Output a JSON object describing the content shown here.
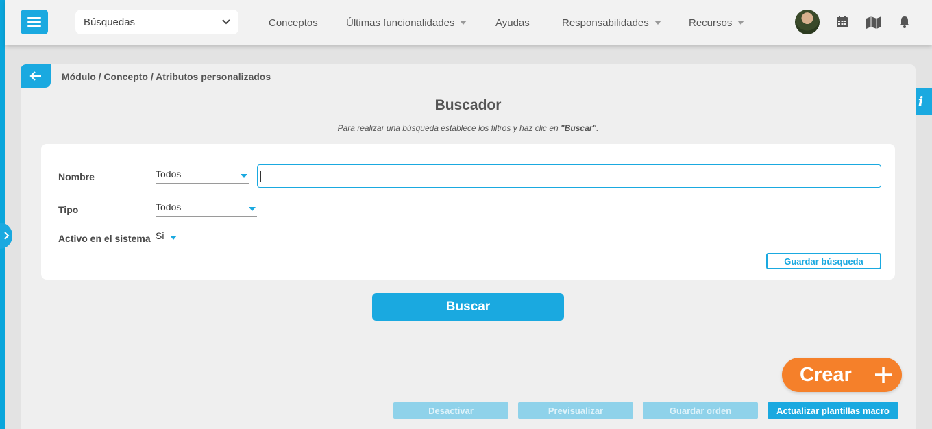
{
  "header": {
    "search_select": "Búsquedas",
    "nav": [
      {
        "label": "Conceptos",
        "has_caret": false
      },
      {
        "label": "Últimas funcionalidades",
        "has_caret": true
      },
      {
        "label": "Ayudas",
        "has_caret": false
      },
      {
        "label": "Responsabilidades",
        "has_caret": true
      },
      {
        "label": "Recursos",
        "has_caret": true
      }
    ],
    "icons": [
      "calendar-icon",
      "map-icon",
      "bell-icon"
    ]
  },
  "breadcrumb": "Módulo / Concepto / Atributos personalizados",
  "title": "Buscador",
  "hint": {
    "text": "Para realizar una búsqueda establece los filtros y haz clic en ",
    "emphasis": "\"Buscar\"",
    "suffix": "."
  },
  "filters": {
    "nombre": {
      "label": "Nombre",
      "value": "Todos",
      "input_value": ""
    },
    "tipo": {
      "label": "Tipo",
      "value": "Todos"
    },
    "activo": {
      "label": "Activo en el sistema",
      "value": "Si"
    }
  },
  "buttons": {
    "save_search": "Guardar búsqueda",
    "buscar": "Buscar",
    "crear": "Crear",
    "desactivar": "Desactivar",
    "previsualizar": "Previsualizar",
    "guardar_orden": "Guardar orden",
    "actualizar": "Actualizar plantillas macro"
  },
  "info_tab": "i",
  "colors": {
    "accent": "#1aa9e0",
    "crear": "#f5802a",
    "disabled": "#8fd2ea"
  }
}
